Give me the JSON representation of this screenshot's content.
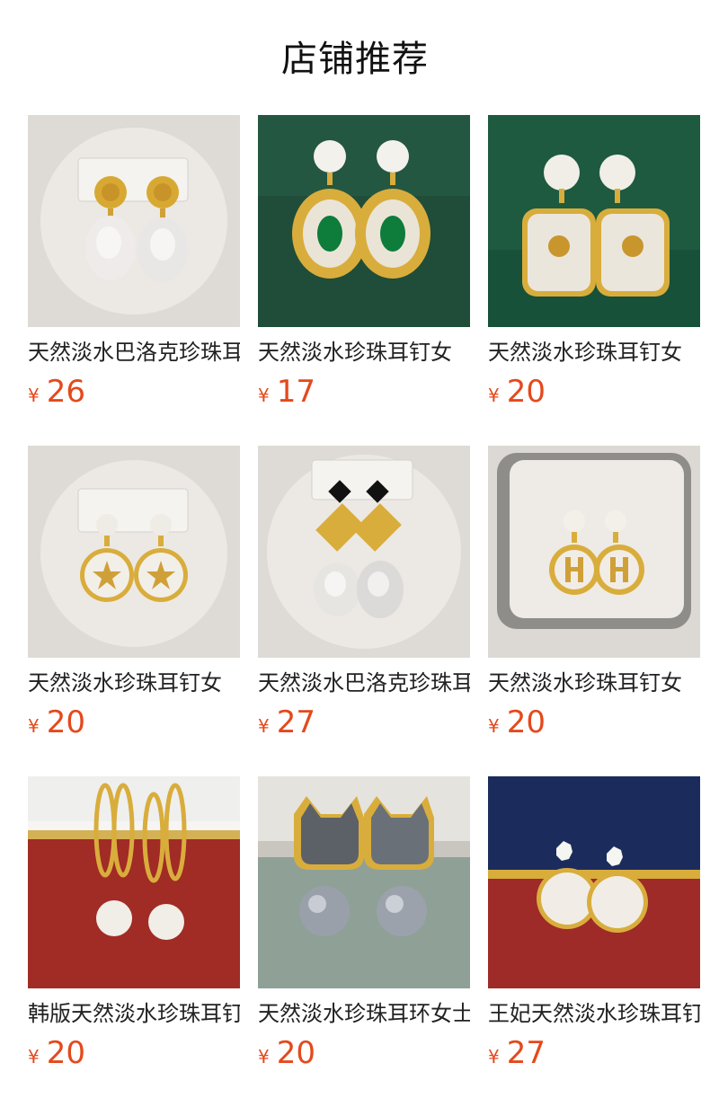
{
  "header": {
    "title": "店铺推荐"
  },
  "currency_symbol": "¥",
  "colors": {
    "price": "#e4491c",
    "text": "#222222",
    "gold": "#d9ad3c",
    "pearl": "#f2efe9"
  },
  "products": [
    {
      "name": "天然淡水巴洛克珍珠耳钉女",
      "price": "26",
      "image": "baroque-pearl-coin-earrings"
    },
    {
      "name": "天然淡水珍珠耳钉女",
      "price": "17",
      "image": "green-gem-pearl-earrings"
    },
    {
      "name": "天然淡水珍珠耳钉女",
      "price": "20",
      "image": "rose-shell-pearl-earrings"
    },
    {
      "name": "天然淡水珍珠耳钉女",
      "price": "20",
      "image": "star-shell-pearl-earrings"
    },
    {
      "name": "天然淡水巴洛克珍珠耳钉女",
      "price": "27",
      "image": "knot-baroque-pearl-earrings"
    },
    {
      "name": "天然淡水珍珠耳钉女",
      "price": "20",
      "image": "h-letter-pearl-earrings"
    },
    {
      "name": "韩版天然淡水珍珠耳钉女",
      "price": "20",
      "image": "bunny-ear-pearl-earrings"
    },
    {
      "name": "天然淡水珍珠耳环女士",
      "price": "20",
      "image": "cat-shell-pearl-earrings"
    },
    {
      "name": "王妃天然淡水珍珠耳钉女",
      "price": "27",
      "image": "round-pearl-stud-earrings"
    }
  ]
}
